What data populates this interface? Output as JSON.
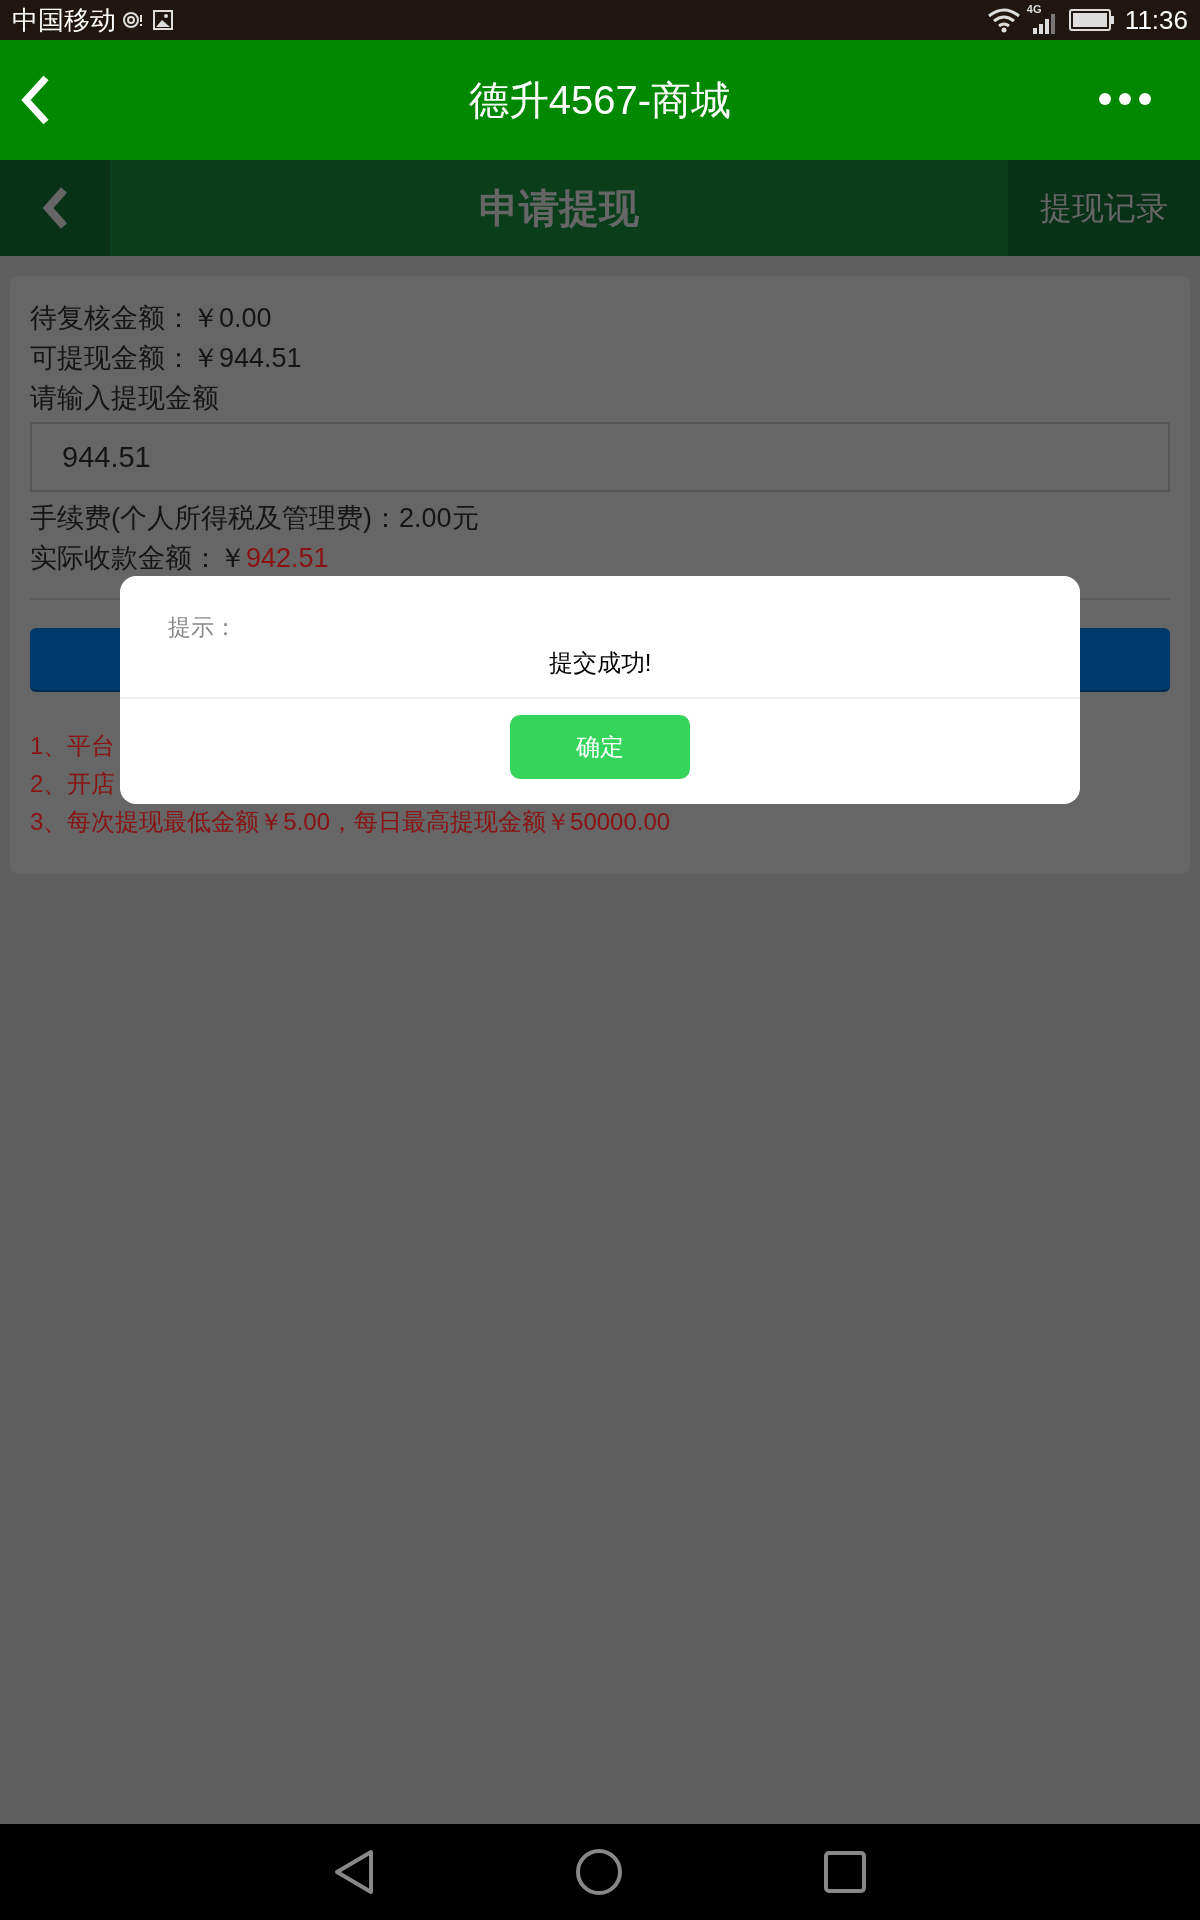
{
  "status_bar": {
    "carrier": "中国移动",
    "network": "4G",
    "time": "11:36"
  },
  "app_header": {
    "title": "德升4567-商城"
  },
  "page_header": {
    "title": "申请提现",
    "action": "提现记录"
  },
  "card": {
    "pending": "待复核金额：￥0.00",
    "available": "可提现金额：￥944.51",
    "input_label": "请输入提现金额",
    "amount_value": "944.51",
    "fee": "手续费(个人所得税及管理费)：2.00元",
    "actual_label": "实际收款金额：￥",
    "actual_value": "942.51",
    "notes": [
      "1、平台",
      "2、开店",
      "3、每次提现最低金额￥5.00，每日最高提现金额￥50000.00"
    ]
  },
  "dialog": {
    "title": "提示：",
    "message": "提交成功!",
    "button": "确定"
  }
}
